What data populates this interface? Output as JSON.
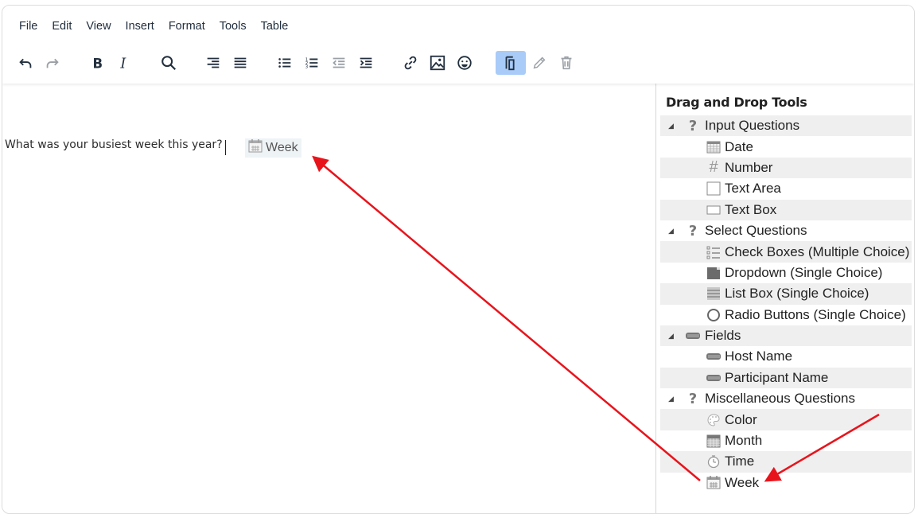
{
  "menubar": {
    "items": [
      "File",
      "Edit",
      "View",
      "Insert",
      "Format",
      "Tools",
      "Table"
    ]
  },
  "toolbar": {
    "buttons": [
      {
        "name": "undo",
        "icon": "undo-icon",
        "enabled": true
      },
      {
        "name": "redo",
        "icon": "redo-icon",
        "enabled": false
      },
      {
        "name": "bold",
        "icon": "bold-icon",
        "enabled": true
      },
      {
        "name": "italic",
        "icon": "italic-icon",
        "enabled": true
      },
      {
        "name": "find",
        "icon": "search-icon",
        "enabled": true
      },
      {
        "name": "align-right",
        "icon": "align-right-icon",
        "enabled": true
      },
      {
        "name": "justify",
        "icon": "align-justify-icon",
        "enabled": true
      },
      {
        "name": "bullet-list",
        "icon": "bullet-list-icon",
        "enabled": true
      },
      {
        "name": "numbered-list",
        "icon": "numbered-list-icon",
        "enabled": true
      },
      {
        "name": "outdent",
        "icon": "outdent-icon",
        "enabled": false
      },
      {
        "name": "indent",
        "icon": "indent-icon",
        "enabled": true
      },
      {
        "name": "link",
        "icon": "link-icon",
        "enabled": true
      },
      {
        "name": "image",
        "icon": "image-icon",
        "enabled": true
      },
      {
        "name": "emoji",
        "icon": "emoji-icon",
        "enabled": true
      },
      {
        "name": "copy-field",
        "icon": "copy-icon",
        "enabled": true,
        "active": true
      },
      {
        "name": "edit",
        "icon": "pencil-icon",
        "enabled": false
      },
      {
        "name": "delete",
        "icon": "trash-icon",
        "enabled": false
      }
    ]
  },
  "editor": {
    "question_text": "What was your busiest week this year?",
    "inserted_field": {
      "label": "Week",
      "icon": "calendar-week-icon"
    }
  },
  "panel": {
    "title": "Drag and Drop Tools",
    "groups": [
      {
        "label": "Input Questions",
        "icon": "question-icon",
        "items": [
          {
            "label": "Date",
            "icon": "calendar-icon"
          },
          {
            "label": "Number",
            "icon": "hash-icon"
          },
          {
            "label": "Text Area",
            "icon": "textarea-icon"
          },
          {
            "label": "Text Box",
            "icon": "textbox-icon"
          }
        ]
      },
      {
        "label": "Select Questions",
        "icon": "question-icon",
        "items": [
          {
            "label": "Check Boxes (Multiple Choice)",
            "icon": "checklist-icon"
          },
          {
            "label": "Dropdown (Single Choice)",
            "icon": "dropdown-icon"
          },
          {
            "label": "List Box (Single Choice)",
            "icon": "listbox-icon"
          },
          {
            "label": "Radio Buttons (Single Choice)",
            "icon": "radio-icon"
          }
        ]
      },
      {
        "label": "Fields",
        "icon": "field-icon",
        "items": [
          {
            "label": "Host Name",
            "icon": "field-icon"
          },
          {
            "label": "Participant Name",
            "icon": "field-icon"
          }
        ]
      },
      {
        "label": "Miscellaneous Questions",
        "icon": "question-icon",
        "items": [
          {
            "label": "Color",
            "icon": "palette-icon"
          },
          {
            "label": "Month",
            "icon": "calendar-month-icon"
          },
          {
            "label": "Time",
            "icon": "stopwatch-icon"
          },
          {
            "label": "Week",
            "icon": "calendar-week-icon"
          }
        ]
      }
    ]
  },
  "annotation": {
    "color": "#e8141c"
  },
  "colors": {
    "active_button": "#a8cbf8",
    "chip_bg": "#eef3f6",
    "row_shade": "#efefef"
  }
}
